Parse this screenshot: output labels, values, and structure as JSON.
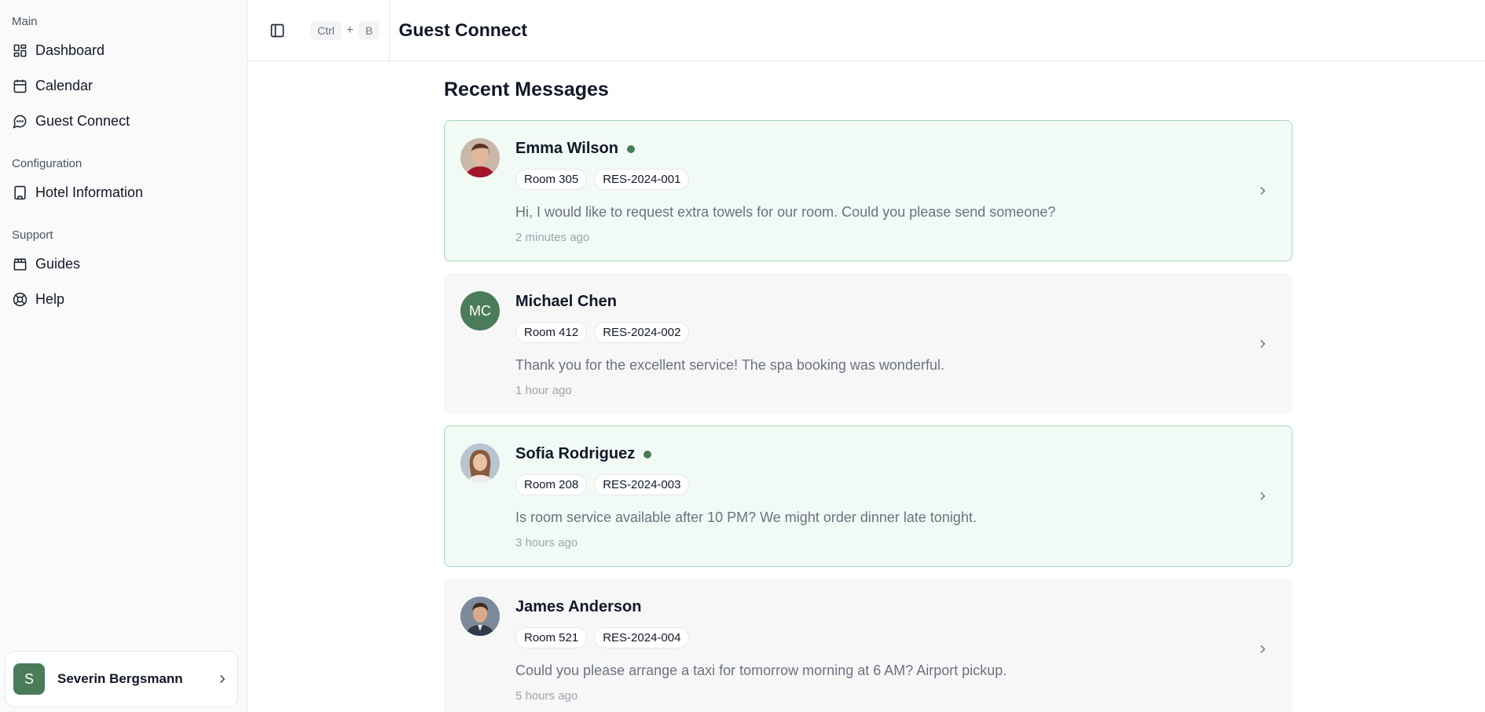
{
  "sidebar": {
    "sections": [
      {
        "label": "Main",
        "items": [
          {
            "label": "Dashboard",
            "icon": "dashboard-icon"
          },
          {
            "label": "Calendar",
            "icon": "calendar-icon"
          },
          {
            "label": "Guest Connect",
            "icon": "message-circle-icon"
          }
        ]
      },
      {
        "label": "Configuration",
        "items": [
          {
            "label": "Hotel Information",
            "icon": "building-icon"
          }
        ]
      },
      {
        "label": "Support",
        "items": [
          {
            "label": "Guides",
            "icon": "clapperboard-icon"
          },
          {
            "label": "Help",
            "icon": "lifebuoy-icon"
          }
        ]
      }
    ],
    "user": {
      "initial": "S",
      "name": "Severin Bergsmann"
    }
  },
  "topbar": {
    "shortcut_key1": "Ctrl",
    "shortcut_plus": "+",
    "shortcut_key2": "B",
    "title": "Guest Connect"
  },
  "main": {
    "section_title": "Recent Messages",
    "messages": [
      {
        "name": "Emma Wilson",
        "online": true,
        "unread": true,
        "avatar": "photo",
        "room": "Room 305",
        "reservation": "RES-2024-001",
        "text": "Hi, I would like to request extra towels for our room. Could you please send someone?",
        "time": "2 minutes ago"
      },
      {
        "name": "Michael Chen",
        "online": false,
        "unread": false,
        "avatar": "initials",
        "initials": "MC",
        "room": "Room 412",
        "reservation": "RES-2024-002",
        "text": "Thank you for the excellent service! The spa booking was wonderful.",
        "time": "1 hour ago"
      },
      {
        "name": "Sofia Rodriguez",
        "online": true,
        "unread": true,
        "avatar": "photo",
        "room": "Room 208",
        "reservation": "RES-2024-003",
        "text": "Is room service available after 10 PM? We might order dinner late tonight.",
        "time": "3 hours ago"
      },
      {
        "name": "James Anderson",
        "online": false,
        "unread": false,
        "avatar": "photo",
        "room": "Room 521",
        "reservation": "RES-2024-004",
        "text": "Could you please arrange a taxi for tomorrow morning at 6 AM? Airport pickup.",
        "time": "5 hours ago"
      }
    ]
  },
  "colors": {
    "accent": "#4a7c59",
    "unread_bg": "#f1faf5",
    "unread_border": "#a7d9bc"
  }
}
